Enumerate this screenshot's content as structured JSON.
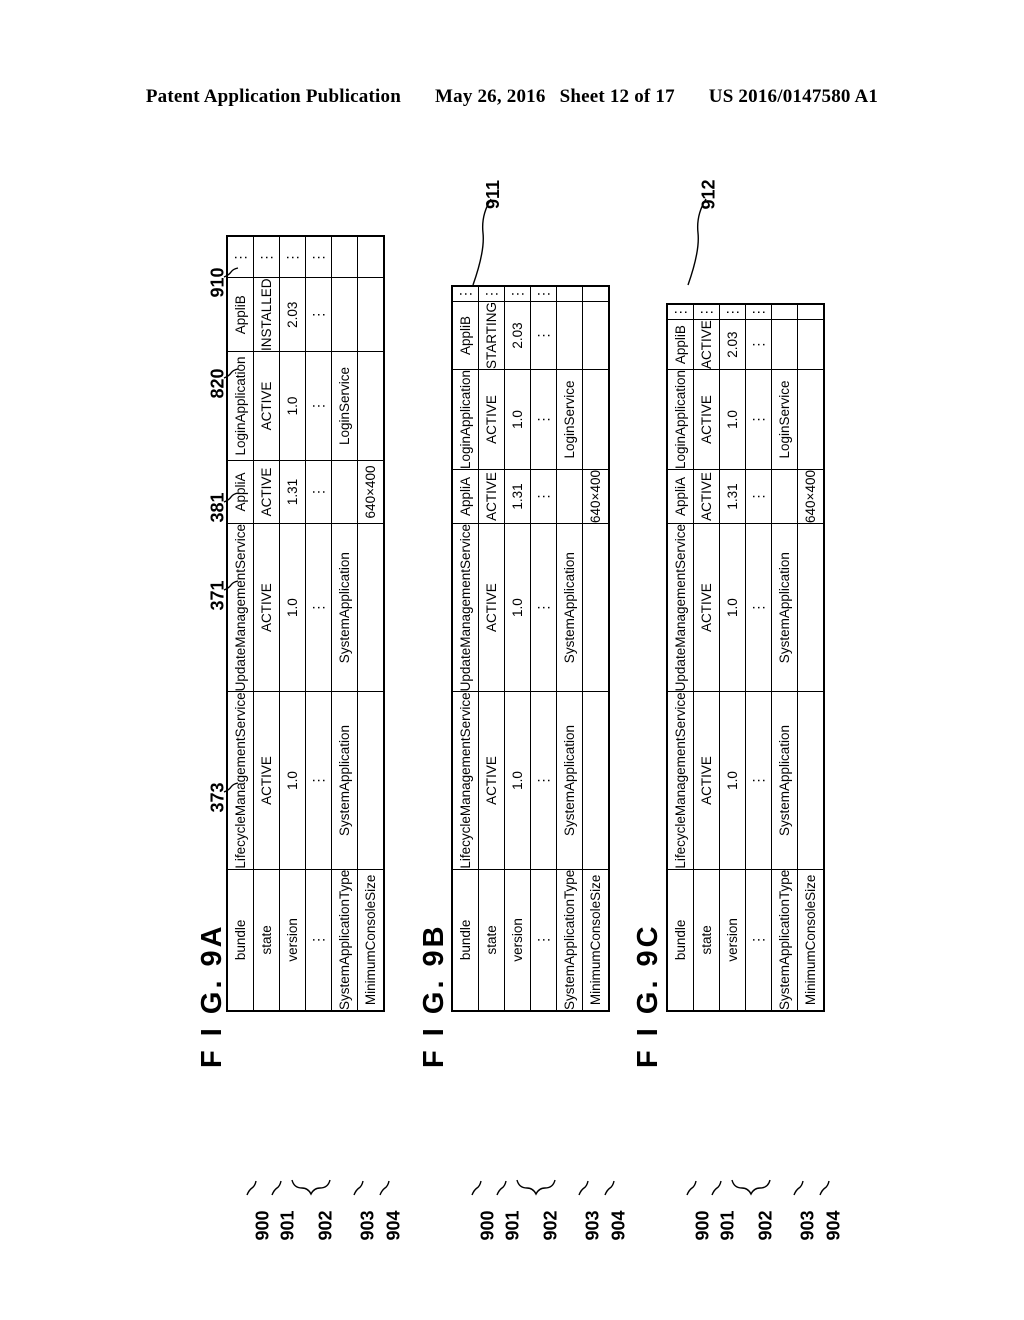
{
  "header": {
    "publication": "Patent Application Publication",
    "date": "May 26, 2016",
    "sheet": "Sheet 12 of 17",
    "patent_number": "US 2016/0147580 A1"
  },
  "row_labels": {
    "bundle": "bundle",
    "state": "state",
    "version": "version",
    "ellipsis": "⋮",
    "system_application_type": "SystemApplicationType",
    "minimum_console_size": "MinimumConsoleSize"
  },
  "row_refs": {
    "bundle": "900",
    "state": "901",
    "version_group": "902",
    "system_application_type": "903",
    "minimum_console_size": "904"
  },
  "column_refs": {
    "lifecycle": "373",
    "update": "371",
    "appliA": "381",
    "login": "820",
    "appliB": "910"
  },
  "callouts": {
    "fig9b_state": "911",
    "fig9c_state": "912"
  },
  "figures": [
    {
      "id": "fig9a",
      "title": "F I G.  9A",
      "columns": [
        {
          "bundle": "LifecycleManagementService",
          "state": "ACTIVE",
          "version": "1.0",
          "ellipsis": "⋮",
          "system_application_type": "SystemApplication",
          "minimum_console_size": ""
        },
        {
          "bundle": "UpdateManagementService",
          "state": "ACTIVE",
          "version": "1.0",
          "ellipsis": "⋮",
          "system_application_type": "SystemApplication",
          "minimum_console_size": ""
        },
        {
          "bundle": "AppliA",
          "state": "ACTIVE",
          "version": "1.31",
          "ellipsis": "⋮",
          "system_application_type": "",
          "minimum_console_size": "640×400"
        },
        {
          "bundle": "LoginApplication",
          "state": "ACTIVE",
          "version": "1.0",
          "ellipsis": "⋮",
          "system_application_type": "LoginService",
          "minimum_console_size": ""
        },
        {
          "bundle": "AppliB",
          "state": "INSTALLED",
          "version": "2.03",
          "ellipsis": "⋮",
          "system_application_type": "",
          "minimum_console_size": ""
        },
        {
          "bundle": "⋮",
          "state": "⋮",
          "version": "⋮",
          "ellipsis": "⋮",
          "system_application_type": "",
          "minimum_console_size": ""
        }
      ]
    },
    {
      "id": "fig9b",
      "title": "F I G.  9B",
      "columns": [
        {
          "bundle": "LifecycleManagementService",
          "state": "ACTIVE",
          "version": "1.0",
          "ellipsis": "⋮",
          "system_application_type": "SystemApplication",
          "minimum_console_size": ""
        },
        {
          "bundle": "UpdateManagementService",
          "state": "ACTIVE",
          "version": "1.0",
          "ellipsis": "⋮",
          "system_application_type": "SystemApplication",
          "minimum_console_size": ""
        },
        {
          "bundle": "AppliA",
          "state": "ACTIVE",
          "version": "1.31",
          "ellipsis": "⋮",
          "system_application_type": "",
          "minimum_console_size": "640×400"
        },
        {
          "bundle": "LoginApplication",
          "state": "ACTIVE",
          "version": "1.0",
          "ellipsis": "⋮",
          "system_application_type": "LoginService",
          "minimum_console_size": ""
        },
        {
          "bundle": "AppliB",
          "state": "STARTING",
          "version": "2.03",
          "ellipsis": "⋮",
          "system_application_type": "",
          "minimum_console_size": ""
        },
        {
          "bundle": "⋮",
          "state": "⋮",
          "version": "⋮",
          "ellipsis": "⋮",
          "system_application_type": "",
          "minimum_console_size": ""
        }
      ]
    },
    {
      "id": "fig9c",
      "title": "F I G.  9C",
      "columns": [
        {
          "bundle": "LifecycleManagementService",
          "state": "ACTIVE",
          "version": "1.0",
          "ellipsis": "⋮",
          "system_application_type": "SystemApplication",
          "minimum_console_size": ""
        },
        {
          "bundle": "UpdateManagementService",
          "state": "ACTIVE",
          "version": "1.0",
          "ellipsis": "⋮",
          "system_application_type": "SystemApplication",
          "minimum_console_size": ""
        },
        {
          "bundle": "AppliA",
          "state": "ACTIVE",
          "version": "1.31",
          "ellipsis": "⋮",
          "system_application_type": "",
          "minimum_console_size": "640×400"
        },
        {
          "bundle": "LoginApplication",
          "state": "ACTIVE",
          "version": "1.0",
          "ellipsis": "⋮",
          "system_application_type": "LoginService",
          "minimum_console_size": ""
        },
        {
          "bundle": "AppliB",
          "state": "ACTIVE",
          "version": "2.03",
          "ellipsis": "⋮",
          "system_application_type": "",
          "minimum_console_size": ""
        },
        {
          "bundle": "⋮",
          "state": "⋮",
          "version": "⋮",
          "ellipsis": "⋮",
          "system_application_type": "",
          "minimum_console_size": ""
        }
      ]
    }
  ]
}
